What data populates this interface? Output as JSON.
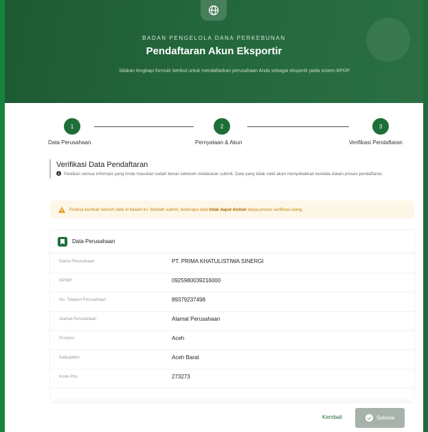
{
  "header": {
    "agency": "BADAN PENGELOLA DANA PERKEBUNAN",
    "title": "Pendaftaran Akun Eksportir",
    "subtitle": "Silakan lengkapi formulir berikut untuk mendaftarkan perusahaan Anda sebagai eksportir pada sistem BPDP.",
    "icon": "globe-icon"
  },
  "stepper": {
    "steps": [
      {
        "number": "1",
        "label": "Data Perusahaan"
      },
      {
        "number": "2",
        "label": "Pernyataan & Akun"
      },
      {
        "number": "3",
        "label": "Verifikasi Pendaftaran"
      }
    ],
    "active_step": 3
  },
  "verification": {
    "title": "Verifikasi Data Pendaftaran",
    "info": "Pastikan semua informasi yang Anda masukan sudah benar sebelum melakukan submit. Data yang tidak valid akan menyebabkan kendala dalam proses pendaftaran."
  },
  "warning": {
    "text_before": "Periksa kembali seluruh data di bawah ini. Setelah submit, beberapa data ",
    "text_bold": "tidak dapat diubah",
    "text_after": " tanpa proses verifikasi ulang."
  },
  "company_section": {
    "title": "Data Perusahaan",
    "icon": "bookmark-icon",
    "rows": [
      {
        "label": "Nama Perusahaan",
        "value": "PT. PRIMA KHATULISTIWA SINERGI"
      },
      {
        "label": "NPWP",
        "value": "0925980039216000"
      },
      {
        "label": "No. Telepon Perusahaan",
        "value": "89379237498"
      },
      {
        "label": "Alamat Perusahaan",
        "value": "Alamat Perusahaan"
      },
      {
        "label": "Provinsi",
        "value": "Aceh"
      },
      {
        "label": "Kabupaten",
        "value": "Aceh Barat"
      },
      {
        "label": "Kode Pos",
        "value": "273273"
      }
    ]
  },
  "actions": {
    "back_label": "Kembali",
    "submit_label": "Selesai"
  },
  "colors": {
    "brand_green": "#1e6e38",
    "header_green": "#24663c",
    "warning_text": "#c9840e",
    "warning_bg": "#fdf7e8",
    "submit_disabled": "#a7b3aa"
  }
}
